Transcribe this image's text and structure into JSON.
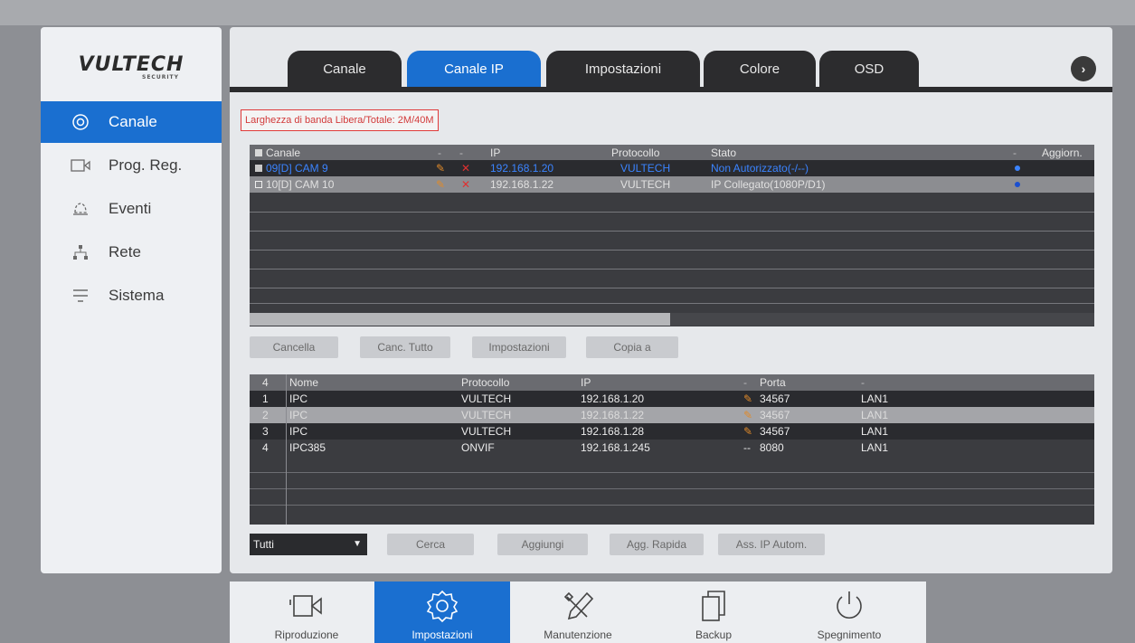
{
  "brand": {
    "name": "VULTECH",
    "sub": "SECURITY"
  },
  "sidebar": {
    "items": [
      {
        "label": "Canale",
        "icon": "camera-channel-icon",
        "active": true
      },
      {
        "label": "Prog. Reg.",
        "icon": "record-schedule-icon",
        "active": false
      },
      {
        "label": "Eventi",
        "icon": "alarm-bell-icon",
        "active": false
      },
      {
        "label": "Rete",
        "icon": "network-icon",
        "active": false
      },
      {
        "label": "Sistema",
        "icon": "system-list-icon",
        "active": false
      }
    ]
  },
  "tabs": [
    {
      "label": "Canale",
      "active": false
    },
    {
      "label": "Canale IP",
      "active": true
    },
    {
      "label": "Impostazioni",
      "active": false
    },
    {
      "label": "Colore",
      "active": false
    },
    {
      "label": "OSD",
      "active": false
    }
  ],
  "bandwidth_label": "Larghezza di banda Libera/Totale: 2M/40M",
  "channels_table": {
    "headers": {
      "channel": "Canale",
      "ip": "IP",
      "protocol": "Protocollo",
      "status": "Stato",
      "update": "Aggiorn."
    },
    "rows": [
      {
        "channel": "09[D] CAM 9",
        "ip": "192.168.1.20",
        "protocol": "VULTECH",
        "status": "Non Autorizzato(-/--)"
      },
      {
        "channel": "10[D] CAM 10",
        "ip": "192.168.1.22",
        "protocol": "VULTECH",
        "status": "IP Collegato(1080P/D1)"
      }
    ]
  },
  "channel_buttons": {
    "delete": "Cancella",
    "delete_all": "Canc. Tutto",
    "settings": "Impostazioni",
    "copy": "Copia a"
  },
  "devices_table": {
    "headers": {
      "count": "4",
      "name": "Nome",
      "protocol": "Protocollo",
      "ip": "IP",
      "dash": "-",
      "port": "Porta",
      "lan": "-"
    },
    "rows": [
      {
        "num": "1",
        "name": "IPC",
        "protocol": "VULTECH",
        "ip": "192.168.1.20",
        "port": "34567",
        "lan": "LAN1",
        "mark": "edit"
      },
      {
        "num": "2",
        "name": "IPC",
        "protocol": "VULTECH",
        "ip": "192.168.1.22",
        "port": "34567",
        "lan": "LAN1",
        "mark": "edit"
      },
      {
        "num": "3",
        "name": "IPC",
        "protocol": "VULTECH",
        "ip": "192.168.1.28",
        "port": "34567",
        "lan": "LAN1",
        "mark": "edit"
      },
      {
        "num": "4",
        "name": "IPC385",
        "protocol": "ONVIF",
        "ip": "192.168.1.245",
        "port": "8080",
        "lan": "LAN1",
        "mark": "--"
      }
    ]
  },
  "filter": {
    "value": "Tutti"
  },
  "search_buttons": {
    "search": "Cerca",
    "add": "Aggiungi",
    "quick_add": "Agg. Rapida",
    "auto_ip": "Ass. IP Autom."
  },
  "dock": [
    {
      "label": "Riproduzione",
      "icon": "playback-camera-icon",
      "active": false
    },
    {
      "label": "Impostazioni",
      "icon": "settings-gear-icon",
      "active": true
    },
    {
      "label": "Manutenzione",
      "icon": "maintenance-tools-icon",
      "active": false
    },
    {
      "label": "Backup",
      "icon": "backup-files-icon",
      "active": false
    },
    {
      "label": "Spegnimento",
      "icon": "power-icon",
      "active": false
    }
  ],
  "colors": {
    "accent": "#1a6fd0",
    "row_selected_text": "#3b84ff",
    "edit_mark": "#e08a2a",
    "delete_mark": "#e03030"
  }
}
